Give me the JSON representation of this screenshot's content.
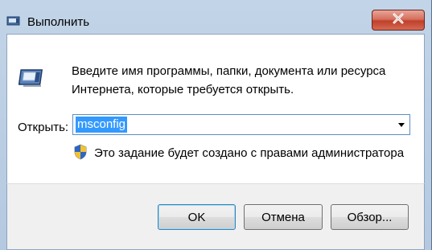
{
  "window": {
    "title": "Выполнить",
    "close_icon": "close-icon"
  },
  "content": {
    "icon": "run-dialog-icon",
    "description_line1": "Введите имя программы, папки, документа или ресурса",
    "description_line2": "Интернета, которые требуется открыть.",
    "open_label": "Открыть:",
    "open_value": "msconfig",
    "admin_icon": "uac-shield-icon",
    "admin_note": "Это задание будет создано с правами администратора"
  },
  "buttons": {
    "ok": "OK",
    "cancel": "Отмена",
    "browse": "Обзор..."
  },
  "colors": {
    "selection": "#3399ff",
    "close_button": "#c0402c",
    "frame": "#b4c9e0"
  }
}
